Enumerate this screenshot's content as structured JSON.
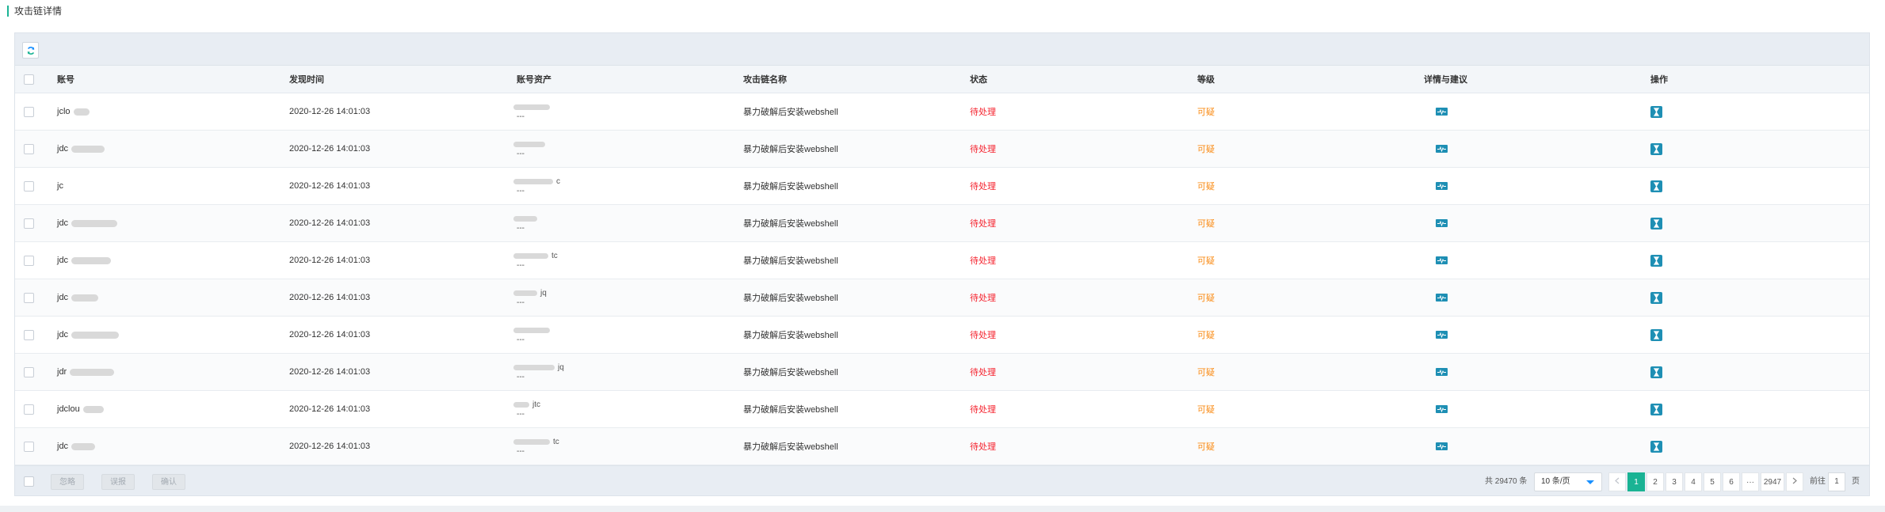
{
  "section_title": "攻击链详情",
  "colors": {
    "accent": "#1ab394",
    "status_pending": "#f5222d",
    "level_suspicious": "#fa8c16",
    "icon_blue": "#1e8fb4"
  },
  "toolbar": {
    "refresh_icon": "refresh-icon"
  },
  "columns": [
    "账号",
    "发现时间",
    "账号资产",
    "攻击链名称",
    "状态",
    "等级",
    "详情与建议",
    "操作"
  ],
  "rows": [
    {
      "account": "jclo",
      "time": "2020-12-26 14:01:03",
      "asset_top": "",
      "asset_bottom": "---",
      "chain": "暴力破解后安装webshell",
      "status": "待处理",
      "level": "可疑"
    },
    {
      "account": "jdc",
      "time": "2020-12-26 14:01:03",
      "asset_top": "",
      "asset_bottom": "---",
      "chain": "暴力破解后安装webshell",
      "status": "待处理",
      "level": "可疑"
    },
    {
      "account": "jc",
      "time": "2020-12-26 14:01:03",
      "asset_top": "c",
      "asset_bottom": "---",
      "chain": "暴力破解后安装webshell",
      "status": "待处理",
      "level": "可疑"
    },
    {
      "account": "jdc",
      "time": "2020-12-26 14:01:03",
      "asset_top": "",
      "asset_bottom": "---",
      "chain": "暴力破解后安装webshell",
      "status": "待处理",
      "level": "可疑"
    },
    {
      "account": "jdc",
      "time": "2020-12-26 14:01:03",
      "asset_top": "tc",
      "asset_bottom": "---",
      "chain": "暴力破解后安装webshell",
      "status": "待处理",
      "level": "可疑"
    },
    {
      "account": "jdc",
      "time": "2020-12-26 14:01:03",
      "asset_top": "jq",
      "asset_bottom": "---",
      "chain": "暴力破解后安装webshell",
      "status": "待处理",
      "level": "可疑"
    },
    {
      "account": "jdc",
      "time": "2020-12-26 14:01:03",
      "asset_top": "",
      "asset_bottom": "---",
      "chain": "暴力破解后安装webshell",
      "status": "待处理",
      "level": "可疑"
    },
    {
      "account": "jdr",
      "time": "2020-12-26 14:01:03",
      "asset_top": "jq",
      "asset_bottom": "---",
      "chain": "暴力破解后安装webshell",
      "status": "待处理",
      "level": "可疑"
    },
    {
      "account": "jdclou",
      "time": "2020-12-26 14:01:03",
      "asset_top": "jtc",
      "asset_bottom": "---",
      "chain": "暴力破解后安装webshell",
      "status": "待处理",
      "level": "可疑"
    },
    {
      "account": "jdc",
      "time": "2020-12-26 14:01:03",
      "asset_top": "tc",
      "asset_bottom": "---",
      "chain": "暴力破解后安装webshell",
      "status": "待处理",
      "level": "可疑"
    }
  ],
  "footer": {
    "ignore_label": "忽略",
    "report_label": "误报",
    "confirm_label": "确认",
    "total_text": "共 29470 条",
    "page_size": "10 条/页",
    "pages": [
      "1",
      "2",
      "3",
      "4",
      "5",
      "6",
      "···",
      "2947"
    ],
    "goto_label": "前往",
    "goto_value": "1",
    "page_unit": "页"
  }
}
